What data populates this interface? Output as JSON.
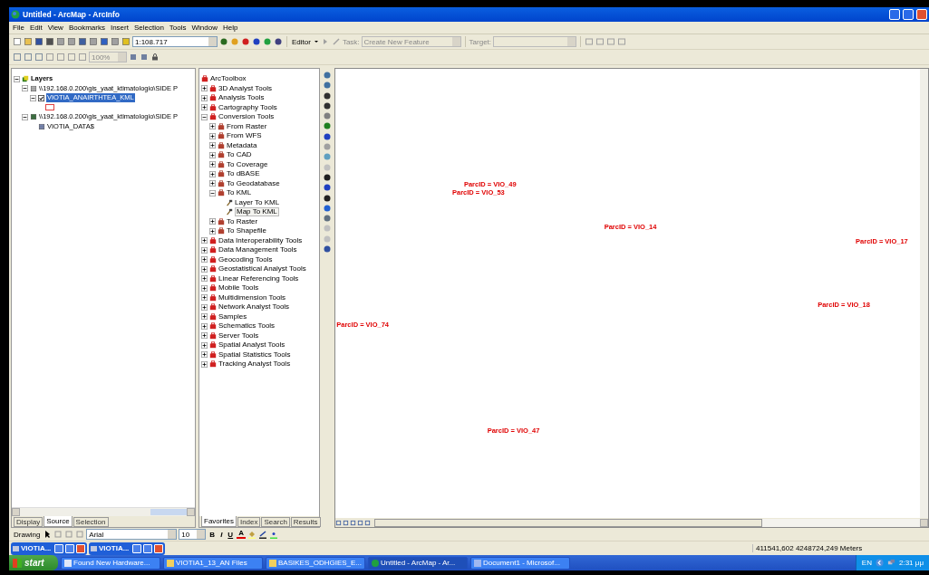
{
  "window": {
    "title": "Untitled - ArcMap - ArcInfo"
  },
  "menu": [
    "File",
    "Edit",
    "View",
    "Bookmarks",
    "Insert",
    "Selection",
    "Tools",
    "Window",
    "Help"
  ],
  "toolbar": {
    "scale": "1:108.717",
    "editor": "Editor",
    "task_label": "Task:",
    "task": "Create New Feature",
    "target_label": "Target:"
  },
  "toolbar2": {
    "zoom": "100%"
  },
  "toc": {
    "root": "Layers",
    "expanded": true,
    "children": [
      {
        "label": "\\\\192.168.0.200\\gis_yaat_ktimatologio\\SIDE P",
        "kind": "database",
        "expanded": true,
        "children": [
          {
            "label": "VIOTIA_ANAIRTHTEA_KML",
            "kind": "layer",
            "expanded": true,
            "checked": true,
            "selected": true
          }
        ]
      },
      {
        "label": "\\\\192.168.0.200\\gis_yaat_ktimatologio\\SIDE P",
        "kind": "connection",
        "expanded": true,
        "children": [
          {
            "label": "VIOTIA_DATA$",
            "kind": "table",
            "selected": false
          }
        ]
      }
    ],
    "tabs": [
      {
        "label": "Display",
        "selected": false
      },
      {
        "label": "Source",
        "selected": true
      },
      {
        "label": "Selection",
        "selected": false
      }
    ]
  },
  "toolbox": {
    "root": "ArcToolbox",
    "items": [
      {
        "label": "3D Analyst Tools",
        "kind": "toolbox",
        "expanded": false
      },
      {
        "label": "Analysis Tools",
        "kind": "toolbox",
        "expanded": false
      },
      {
        "label": "Cartography Tools",
        "kind": "toolbox",
        "expanded": false
      },
      {
        "label": "Conversion Tools",
        "kind": "toolbox",
        "expanded": true,
        "children": [
          {
            "label": "From Raster",
            "kind": "toolset",
            "expanded": false
          },
          {
            "label": "From WFS",
            "kind": "toolset",
            "expanded": false
          },
          {
            "label": "Metadata",
            "kind": "toolset",
            "expanded": false
          },
          {
            "label": "To CAD",
            "kind": "toolset",
            "expanded": false
          },
          {
            "label": "To Coverage",
            "kind": "toolset",
            "expanded": false
          },
          {
            "label": "To dBASE",
            "kind": "toolset",
            "expanded": false
          },
          {
            "label": "To Geodatabase",
            "kind": "toolset",
            "expanded": false
          },
          {
            "label": "To KML",
            "kind": "toolset",
            "expanded": true,
            "children": [
              {
                "label": "Layer To KML",
                "kind": "tool",
                "selected": false
              },
              {
                "label": "Map To KML",
                "kind": "tool",
                "selected": true
              }
            ]
          },
          {
            "label": "To Raster",
            "kind": "toolset",
            "expanded": false
          },
          {
            "label": "To Shapefile",
            "kind": "toolset",
            "expanded": false
          }
        ]
      },
      {
        "label": "Data Interoperability Tools",
        "kind": "toolbox",
        "expanded": false
      },
      {
        "label": "Data Management Tools",
        "kind": "toolbox",
        "expanded": false
      },
      {
        "label": "Geocoding Tools",
        "kind": "toolbox",
        "expanded": false
      },
      {
        "label": "Geostatistical Analyst Tools",
        "kind": "toolbox",
        "expanded": false
      },
      {
        "label": "Linear Referencing Tools",
        "kind": "toolbox",
        "expanded": false
      },
      {
        "label": "Mobile Tools",
        "kind": "toolbox",
        "expanded": false
      },
      {
        "label": "Multidimension Tools",
        "kind": "toolbox",
        "expanded": false
      },
      {
        "label": "Network Analyst Tools",
        "kind": "toolbox",
        "expanded": false
      },
      {
        "label": "Samples",
        "kind": "toolbox",
        "expanded": false
      },
      {
        "label": "Schematics Tools",
        "kind": "toolbox",
        "expanded": false
      },
      {
        "label": "Server Tools",
        "kind": "toolbox",
        "expanded": false
      },
      {
        "label": "Spatial Analyst Tools",
        "kind": "toolbox",
        "expanded": false
      },
      {
        "label": "Spatial Statistics Tools",
        "kind": "toolbox",
        "expanded": false
      },
      {
        "label": "Tracking Analyst Tools",
        "kind": "toolbox",
        "expanded": false
      }
    ],
    "tabs": [
      {
        "label": "Favorites",
        "selected": true
      },
      {
        "label": "Index",
        "selected": false
      },
      {
        "label": "Search",
        "selected": false
      },
      {
        "label": "Results",
        "selected": false
      }
    ]
  },
  "map": {
    "labels": [
      "ParcID = VIO_49",
      "ParcID = VIO_53",
      "ParcID = VIO_14",
      "ParcID = VIO_17",
      "ParcID = VIO_18",
      "ParcID = VIO_74",
      "ParcID = VIO_47"
    ]
  },
  "drawing_toolbar": {
    "menu": "Drawing",
    "font": "Arial",
    "size": "10",
    "format_buttons": [
      "B",
      "I",
      "U"
    ],
    "font_color": "A"
  },
  "floating_windows": [
    {
      "title": "VIOTIA..."
    },
    {
      "title": "VIOTIA..."
    }
  ],
  "status_bar": {
    "coordinates": "411541,602  4248724,249 Meters"
  },
  "taskbar": {
    "start": "start",
    "tasks": [
      {
        "label": "Found New Hardware...",
        "kind": "window",
        "selected": false
      },
      {
        "label": "VIOTIA1_13_AN Files",
        "kind": "folder",
        "selected": false
      },
      {
        "label": "BASIKES_ODHGIES_E...",
        "kind": "folder",
        "selected": false
      },
      {
        "label": "Untitled - ArcMap - Ar...",
        "kind": "globe",
        "selected": true
      },
      {
        "label": "Document1 - Microsof...",
        "kind": "document",
        "selected": false
      }
    ],
    "language": "EN",
    "clock": "2:31 μμ"
  }
}
